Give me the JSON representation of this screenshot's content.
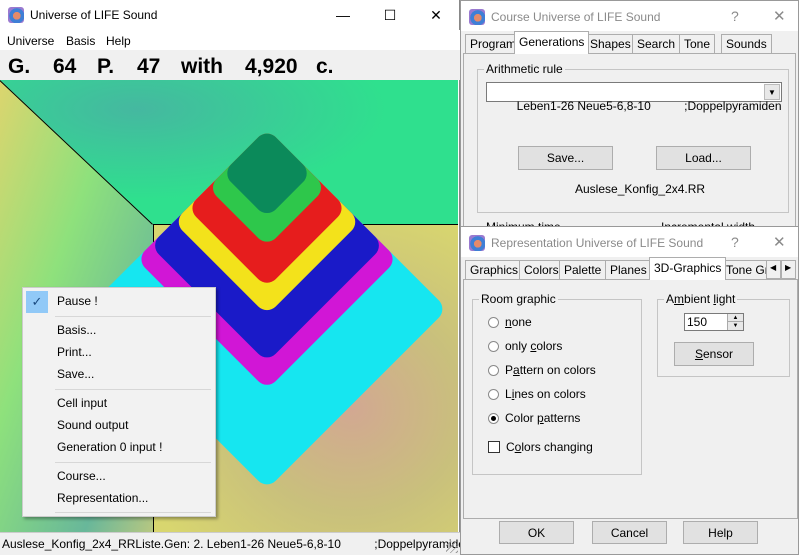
{
  "main": {
    "title": "Universe of LIFE Sound",
    "controls": {
      "minimize": "—",
      "maximize": "☐",
      "close": "✕"
    },
    "menu": [
      "Universe",
      "Basis",
      "Help"
    ],
    "stats": {
      "g_label": "G.",
      "g_value": "64",
      "p_label": "P.",
      "p_value": "47",
      "with_label": "with",
      "cells_value": "4,920",
      "cells_label": "c."
    },
    "status": "Auslese_Konfig_2x4_RRListe.Gen: 2. Leben1-26 Neue5-6,8-10          ;Doppelpyramiden"
  },
  "context_menu": {
    "checked_icon": "✓",
    "items": [
      {
        "label": "Pause !",
        "checked": true
      },
      {
        "label": "Basis..."
      },
      {
        "label": "Print..."
      },
      {
        "label": "Save..."
      },
      {
        "label": "Cell input"
      },
      {
        "label": "Sound output"
      },
      {
        "label": "Generation 0 input !"
      },
      {
        "label": "Course..."
      },
      {
        "label": "Representation..."
      }
    ]
  },
  "course_dialog": {
    "title": "Course Universe of LIFE Sound",
    "help": "?",
    "close": "✕",
    "tabs": [
      "Program",
      "Generations",
      "Shapes",
      "Search",
      "Tone",
      "Sounds"
    ],
    "active_tab": "Generations",
    "group_label": "Arithmetic rule",
    "rule_value": "Leben1-26 Neue5-6,8-10          ;Doppelpyramiden",
    "dropdown_arrow": "▼",
    "save_label": "Save...",
    "load_label": "Load...",
    "file_name": "Auslese_Konfig_2x4.RR",
    "min_time_label": "Minimum time",
    "inc_width_label": "Incremental width"
  },
  "rep_dialog": {
    "title": "Representation Universe of LIFE Sound",
    "help": "?",
    "close": "✕",
    "tabs": [
      "Graphics",
      "Colors",
      "Palette",
      "Planes",
      "3D-Graphics",
      "Tone Gra"
    ],
    "active_tab": "3D-Graphics",
    "scroll_left": "◀",
    "scroll_right": "▶",
    "room_graphic_label": "Room graphic",
    "options": [
      {
        "pre": "",
        "u": "n",
        "post": "one",
        "selected": false
      },
      {
        "pre": "only ",
        "u": "c",
        "post": "olors",
        "selected": false
      },
      {
        "pre": "P",
        "u": "a",
        "post": "ttern on colors",
        "selected": false
      },
      {
        "pre": "L",
        "u": "i",
        "post": "nes on colors",
        "selected": false
      },
      {
        "pre": "Color ",
        "u": "p",
        "post": "atterns",
        "selected": true
      }
    ],
    "colors_changing": {
      "pre": "C",
      "u": "o",
      "post": "lors changing",
      "checked": false
    },
    "ambient_label_pre": "A",
    "ambient_label_u": "m",
    "ambient_label_mid": "bient ",
    "ambient_label_u2": "l",
    "ambient_label_post": "ight",
    "ambient_value": "150",
    "spin_up": "▲",
    "spin_down": "▼",
    "sensor_u": "S",
    "sensor_post": "ensor",
    "ok_label": "OK",
    "cancel_label": "Cancel",
    "help_label": "Help"
  }
}
